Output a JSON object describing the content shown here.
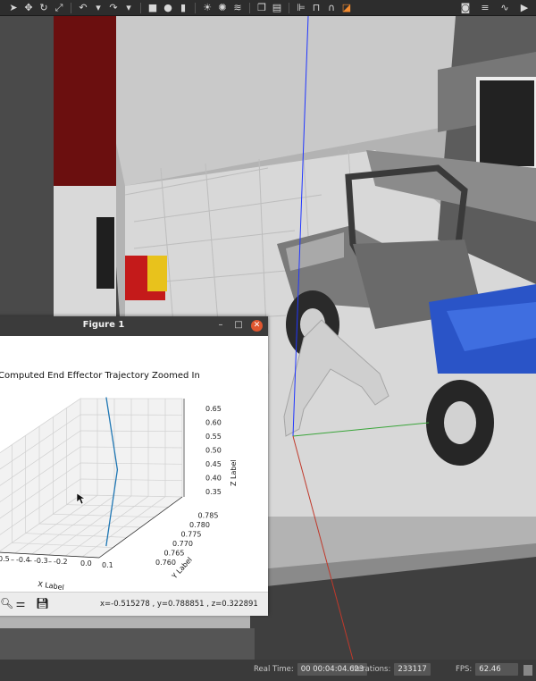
{
  "toolbar": {
    "icons": [
      "select-arrow",
      "translate",
      "rotate",
      "scale",
      "undo",
      "undo-dropdown",
      "redo",
      "redo-dropdown",
      "box",
      "sphere",
      "cylinder",
      "sun",
      "spot-light",
      "directional-light",
      "copy",
      "paste",
      "align",
      "snap",
      "magnet",
      "change-view"
    ],
    "right_icons": [
      "screenshot",
      "log",
      "plot"
    ]
  },
  "figure": {
    "title": "Figure 1",
    "minimize": "–",
    "maximize": "□",
    "close": "✕"
  },
  "chart_data": {
    "type": "line",
    "projection": "3d",
    "title": "Computed End Effector Trajectory Zoomed In",
    "xlabel": "X Label",
    "ylabel": "Y Label",
    "zlabel": "Z Label",
    "xticks": [
      "0.5",
      "-0.4",
      "-0.3",
      "-0.2",
      "0.0",
      "0.1"
    ],
    "xtick_prefix_seps": [
      "",
      "-",
      "",
      ""
    ],
    "yticks": [
      "0.760",
      "0.765",
      "0.770",
      "0.775",
      "0.780",
      "0.785"
    ],
    "zticks": [
      "0.35",
      "0.40",
      "0.45",
      "0.50",
      "0.55",
      "0.60",
      "0.65"
    ],
    "xlim": [
      -0.55,
      0.12
    ],
    "ylim": [
      0.758,
      0.787
    ],
    "zlim": [
      0.32,
      0.66
    ],
    "series": [
      {
        "color": "#1f77b4",
        "points": [
          [
            -0.38,
            0.787,
            0.66
          ],
          [
            -0.1,
            0.776,
            0.49
          ],
          [
            0.09,
            0.762,
            0.33
          ]
        ]
      }
    ],
    "grid": true
  },
  "coords": {
    "text": "x=-0.515278    , y=0.788851    , z=0.322891"
  },
  "statusbar": {
    "real_time_label": "Real Time:",
    "real_time_value": "00 00:04:04.623",
    "iterations_label": "Iterations:",
    "iterations_value": "233117",
    "fps_label": "FPS:",
    "fps_value": "62.46"
  }
}
